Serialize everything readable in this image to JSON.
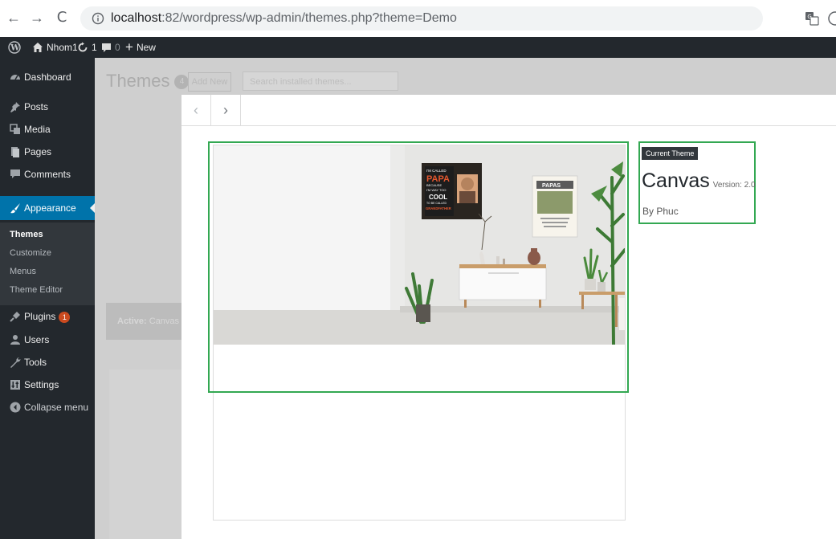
{
  "browser": {
    "url_host": "localhost",
    "url_rest": ":82/wordpress/wp-admin/themes.php?theme=Demo",
    "back_glyph": "←",
    "forward_glyph": "→",
    "reload_glyph": "C"
  },
  "admin_bar": {
    "site_name": "Nhom1",
    "updates_count": "1",
    "comments_count": "0",
    "new_label": "New"
  },
  "sidebar": {
    "items": [
      {
        "label": "Dashboard",
        "icon": "dashboard-icon"
      },
      {
        "label": "Posts",
        "icon": "pin-icon"
      },
      {
        "label": "Media",
        "icon": "media-icon"
      },
      {
        "label": "Pages",
        "icon": "pages-icon"
      },
      {
        "label": "Comments",
        "icon": "comment-icon"
      },
      {
        "label": "Appearance",
        "icon": "brush-icon"
      },
      {
        "label": "Plugins",
        "icon": "plugin-icon",
        "badge": "1"
      },
      {
        "label": "Users",
        "icon": "users-icon"
      },
      {
        "label": "Tools",
        "icon": "wrench-icon"
      },
      {
        "label": "Settings",
        "icon": "settings-icon"
      },
      {
        "label": "Collapse menu",
        "icon": "collapse-icon"
      }
    ],
    "submenu": [
      "Themes",
      "Customize",
      "Menus",
      "Theme Editor"
    ]
  },
  "background": {
    "title": "Themes",
    "count": "4",
    "add_new": "Add New",
    "search_placeholder": "Search installed themes...",
    "active_label": "Active:",
    "active_theme": "Canvas"
  },
  "overlay": {
    "prev_glyph": "‹",
    "next_glyph": "›",
    "current_theme_label": "Current Theme",
    "theme_name": "Canvas",
    "version": "Version: 2.0",
    "author_prefix": "By",
    "author": "Phuc",
    "poster_left": {
      "line1": "I'M CALLED",
      "line2": "PAPA",
      "line3": "BECAUSE",
      "line4": "I'M WAY TOO",
      "line5": "COOL",
      "line6": "TO BE CALLED",
      "line7": "GRANDFATHER"
    },
    "poster_right": {
      "title": "PAPAS"
    }
  },
  "colors": {
    "admin_dark": "#23282d",
    "accent": "#0073aa",
    "highlight": "#33a852",
    "badge": "#ca4a1f"
  }
}
